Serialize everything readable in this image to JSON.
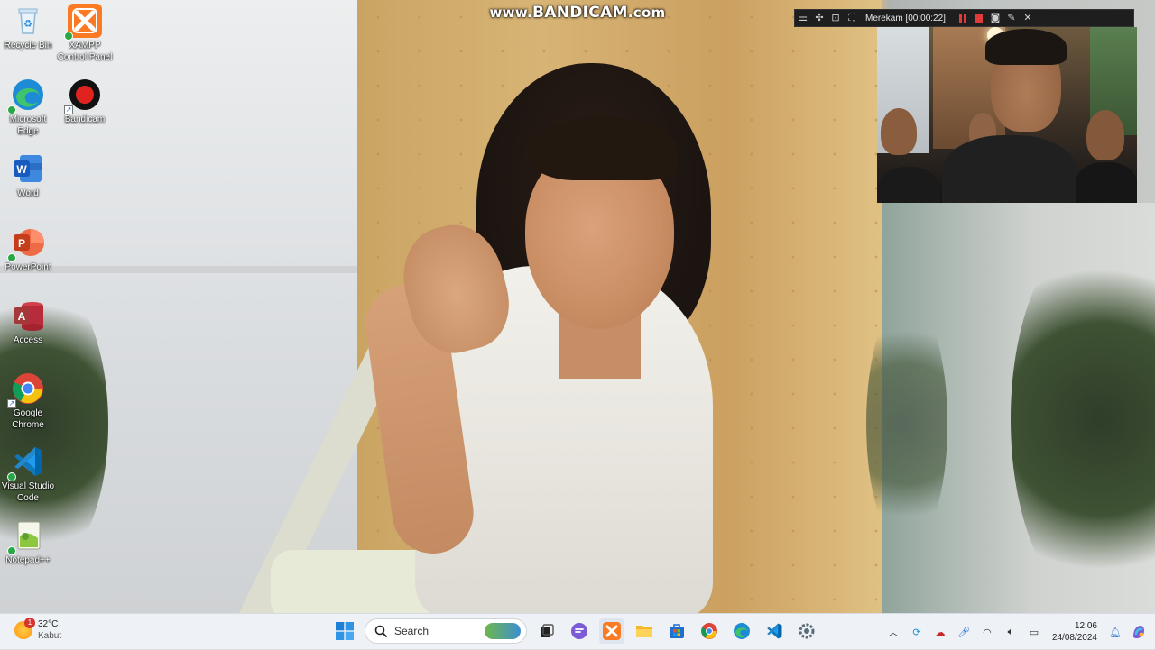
{
  "watermark": {
    "prefix": "www.",
    "brand": "BANDICAM",
    "suffix": ".com"
  },
  "recorder": {
    "status": "Merekam [00:00:22]",
    "icons": [
      "menu-icon",
      "resize-icon",
      "region-icon",
      "fullscreen-icon",
      "pause-icon",
      "stop-icon",
      "camera-icon",
      "pencil-icon",
      "close-icon"
    ]
  },
  "desktop": {
    "icons": [
      {
        "label": "Recycle Bin",
        "icon": "recycle-bin-icon"
      },
      {
        "label": "XAMPP Control Panel",
        "icon": "xampp-icon"
      },
      {
        "label": "Microsoft Edge",
        "icon": "edge-icon"
      },
      {
        "label": "Bandicam",
        "icon": "bandicam-icon"
      },
      {
        "label": "Word",
        "icon": "word-icon"
      },
      {
        "label": "PowerPoint",
        "icon": "powerpoint-icon"
      },
      {
        "label": "Access",
        "icon": "access-icon"
      },
      {
        "label": "Google Chrome",
        "icon": "chrome-icon"
      },
      {
        "label": "Visual Studio Code",
        "icon": "vscode-icon"
      },
      {
        "label": "Notepad++",
        "icon": "notepadpp-icon"
      }
    ]
  },
  "taskbar": {
    "weather": {
      "temp": "32°C",
      "desc": "Kabut",
      "badge": "1"
    },
    "search": {
      "placeholder": "Search"
    },
    "apps": [
      "task-view-icon",
      "chat-icon",
      "xampp-icon",
      "file-explorer-icon",
      "store-icon",
      "chrome-icon",
      "edge-icon",
      "vscode-icon",
      "settings-icon"
    ],
    "clock": {
      "time": "12:06",
      "date": "24/08/2024"
    }
  },
  "colors": {
    "taskbar_bg": "#eef1f5",
    "record_red": "#e03b3b",
    "edge_blue": "#1e8bd6"
  }
}
